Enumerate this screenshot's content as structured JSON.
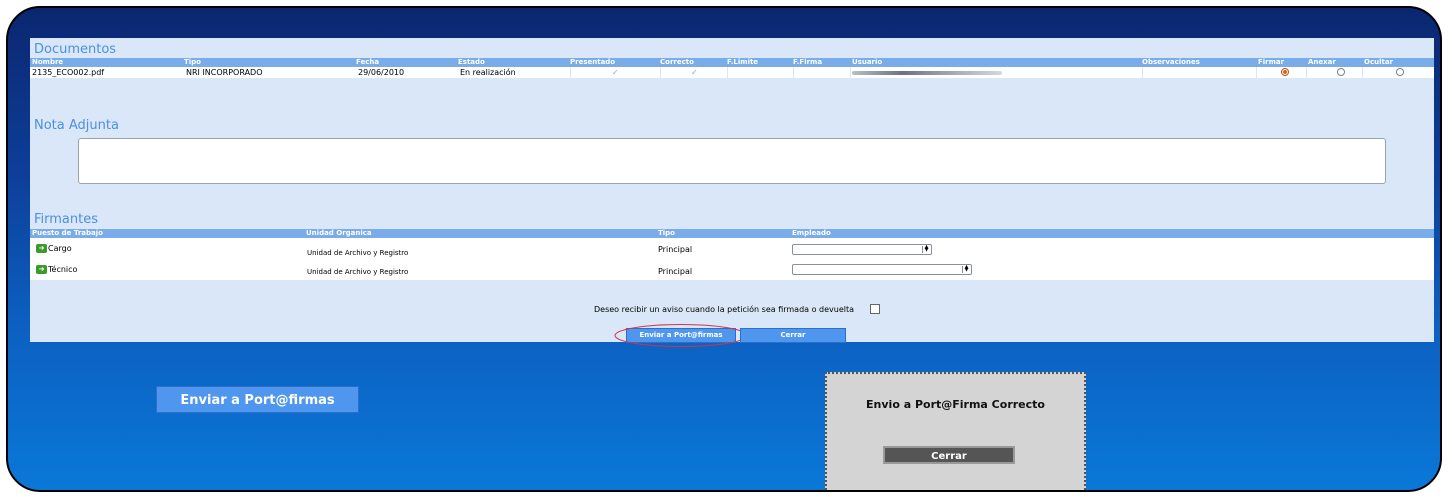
{
  "documentos": {
    "title": "Documentos",
    "columns": [
      "Nombre",
      "Tipo",
      "Fecha",
      "Estado",
      "Presentado",
      "Correcto",
      "F.Limite",
      "F.Firma",
      "Usuario",
      "Observaciones",
      "Firmar",
      "Anexar",
      "Ocultar"
    ],
    "rows": [
      {
        "nombre": "2135_ECO002.pdf",
        "tipo": "NRI INCORPORADO",
        "fecha": "29/06/2010",
        "estado": "En realización",
        "presentado": true,
        "correcto": true,
        "f_limite": "",
        "f_firma": "",
        "usuario": "",
        "observaciones": "",
        "selected": "Firmar"
      }
    ]
  },
  "nota": {
    "title": "Nota Adjunta",
    "value": ""
  },
  "firmantes": {
    "title": "Firmantes",
    "columns": [
      "Puesto de Trabajo",
      "Unidad Organica",
      "Tipo",
      "Empleado"
    ],
    "rows": [
      {
        "puesto": "Cargo",
        "unidad": "Unidad de Archivo y Registro",
        "tipo": "Principal",
        "empleado": ""
      },
      {
        "puesto": "Técnico",
        "unidad": "Unidad de Archivo y Registro",
        "tipo": "Principal",
        "empleado": ""
      }
    ]
  },
  "notify": {
    "label": "Deseo recibir un aviso cuando la petición sea firmada o devuelta",
    "checked": false
  },
  "buttons": {
    "send": "Enviar a Port@firmas",
    "close": "Cerrar"
  },
  "zoom_button": {
    "label": "Enviar a Port@firmas"
  },
  "dialog": {
    "message": "Envio a Port@Firma Correcto",
    "close": "Cerrar"
  },
  "colors": {
    "header": "#7aace9",
    "panel": "#d9e7f8",
    "accent": "#4f96ee",
    "section_title": "#4d8fe0"
  }
}
